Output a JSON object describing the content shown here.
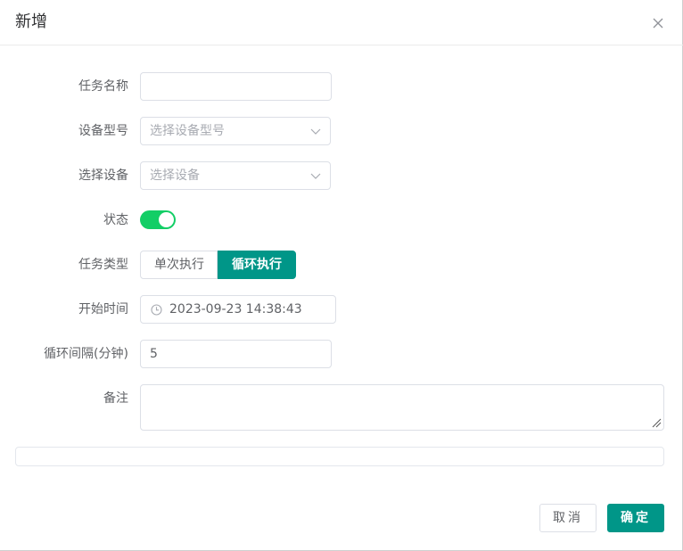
{
  "dialog": {
    "title": "新增",
    "close_icon": "close-icon"
  },
  "form": {
    "task_name": {
      "label": "任务名称",
      "value": ""
    },
    "device_model": {
      "label": "设备型号",
      "placeholder": "选择设备型号"
    },
    "device": {
      "label": "选择设备",
      "placeholder": "选择设备"
    },
    "status": {
      "label": "状态",
      "enabled": true,
      "color": "#13ce66"
    },
    "task_type": {
      "label": "任务类型",
      "options": [
        "单次执行",
        "循环执行"
      ],
      "selected": "循环执行",
      "active_color": "#009688"
    },
    "start_time": {
      "label": "开始时间",
      "value": "2023-09-23 14:38:43",
      "icon": "clock-icon"
    },
    "interval": {
      "label": "循环间隔(分钟)",
      "value": "5"
    },
    "remark": {
      "label": "备注",
      "value": ""
    }
  },
  "footer": {
    "cancel_label": "取消",
    "confirm_label": "确定",
    "accent_color": "#009688"
  }
}
